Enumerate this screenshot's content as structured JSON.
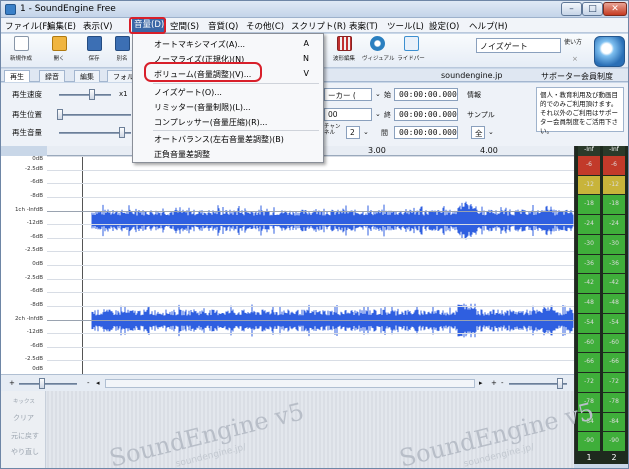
{
  "window": {
    "title": "1 - SoundEngine Free",
    "min": "–",
    "max": "□",
    "close": "✕"
  },
  "menubar": [
    "ファイル(F)",
    "編集(E)",
    "表示(V)",
    "音量(D)",
    "空間(S)",
    "音質(Q)",
    "その他(C)",
    "スクリプト(R)",
    "表案(T)",
    "ツール(L)",
    "設定(O)",
    "ヘルプ(H)"
  ],
  "toolbar": {
    "buttons": [
      {
        "label": "新規作成",
        "icon": "new-file-icon",
        "color": "#ffffff"
      },
      {
        "label": "開く",
        "icon": "folder-open-icon",
        "color": "#f0b540"
      },
      {
        "label": "保存",
        "icon": "save-disk-icon",
        "color": "#3c6fb4"
      },
      {
        "label": "別名",
        "icon": "save-as-icon",
        "color": "#3c6fb4"
      },
      {
        "label": "波形編集",
        "icon": "waveform-edit-icon",
        "color": "#c03030"
      },
      {
        "label": "ヴィジュアル",
        "icon": "visual-icon",
        "color": "#2a7fc0"
      },
      {
        "label": "ライドパー",
        "icon": "rider-icon",
        "color": "#3c8fd0"
      }
    ],
    "noise_gate": "ノイズゲート",
    "how_to": "使い方",
    "x": "×"
  },
  "tabs": [
    "再生",
    "録音",
    "編集",
    "フォル"
  ],
  "links": {
    "site": "soundengine.jp",
    "supporter": "サポーター会員制度"
  },
  "params": {
    "speed_label": "再生速度",
    "speed_value": "x1",
    "position_label": "再生位置",
    "volume_label": "再生音量",
    "marker_combo": "ーカー (",
    "start_label": "始",
    "end_label": "終",
    "length_label": "間",
    "start_time": "00:00:00.000",
    "end_time": "00:00:00.000",
    "length_time": "00:00:00.000",
    "info_label": "情報",
    "sample_label": "サンプル",
    "combo_00": "00",
    "channel_combo": "2",
    "channel_label": "チャン\nネル",
    "all_combo": "全"
  },
  "info_text": "個人・教育利用及び動画目的でのみご利用頂けます。それ以外のご利用はサポーター会員制度をご活用下さい。",
  "ruler": [
    "3.00",
    "4.00"
  ],
  "db_labels": [
    "0dB",
    "-2.5dB",
    "-6dB",
    "-8dB",
    "1ch -InfdB",
    "-12dB",
    "-6dB",
    "-2.5dB",
    "0dB",
    "-2.5dB",
    "-6dB",
    "-8dB",
    "2ch -InfdB",
    "-12dB",
    "-6dB",
    "-2.5dB",
    "0dB"
  ],
  "meter": {
    "header": [
      "-Inf",
      "-Inf"
    ],
    "levels": [
      "-6",
      "-12",
      "-18",
      "-24",
      "-30",
      "-36",
      "-42",
      "-48",
      "-54",
      "-60",
      "-66",
      "-72",
      "-78",
      "-84",
      "-90"
    ],
    "channels": [
      "1",
      "2"
    ]
  },
  "scroll": {
    "plus": "+",
    "minus": "-"
  },
  "side_buttons": [
    "キックス",
    "クリア",
    "元に戻す",
    "やり直し"
  ],
  "watermark": "SoundEngine v5",
  "watermark_url": "soundengine.jp/",
  "dropdown": {
    "items": [
      {
        "label": "オートマキシマイズ(A)...",
        "key": "A"
      },
      {
        "label": "ノーマライズ(正規化)(N)",
        "key": "N"
      },
      {
        "label": "ボリューム(音量調整)(V)...",
        "key": "V"
      },
      {
        "label": "ノイズゲート(O)...",
        "key": ""
      },
      {
        "label": "リミッター(音量制限)(L)...",
        "key": ""
      },
      {
        "label": "コンプレッサー(音量圧縮)(R)...",
        "key": ""
      },
      {
        "label": "オートバランス(左右音量差調整)(B)",
        "key": ""
      },
      {
        "label": "正負音量差調整",
        "key": ""
      }
    ]
  },
  "colors": {
    "wave": "#2f5fe0",
    "highlight": "#d81f2a",
    "meter_green": "#3fae3a",
    "meter_red": "#c23a2a",
    "meter_yellow": "#c8b43a"
  }
}
